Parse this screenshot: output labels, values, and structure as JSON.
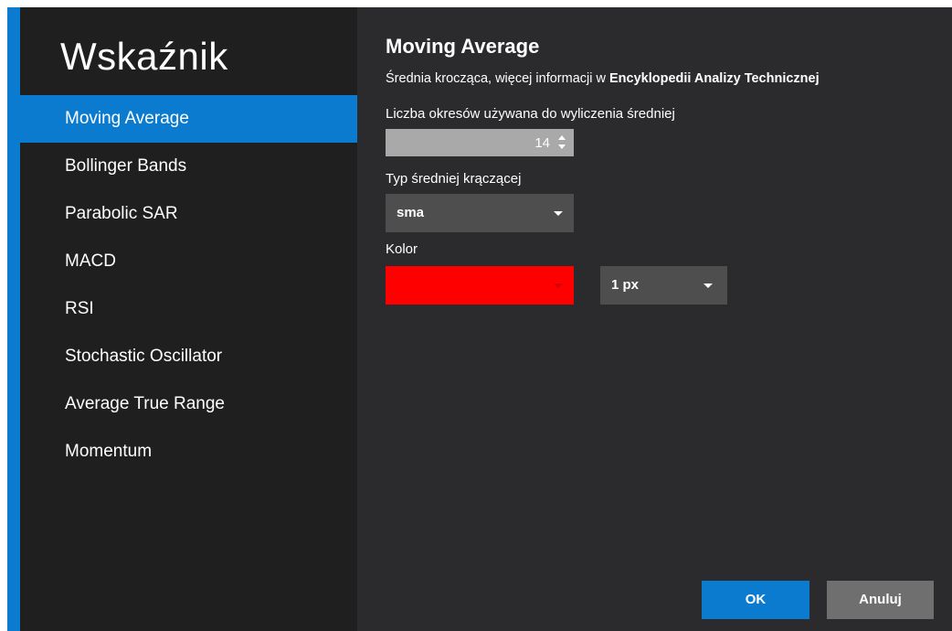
{
  "sidebar": {
    "title": "Wskaźnik",
    "items": [
      {
        "label": "Moving Average",
        "active": true
      },
      {
        "label": "Bollinger Bands"
      },
      {
        "label": "Parabolic SAR"
      },
      {
        "label": "MACD"
      },
      {
        "label": "RSI"
      },
      {
        "label": "Stochastic Oscillator"
      },
      {
        "label": "Average True Range"
      },
      {
        "label": "Momentum"
      }
    ]
  },
  "main": {
    "title": "Moving Average",
    "description_prefix": "Średnia krocząca, więcej informacji w ",
    "description_link": "Encyklopedii Analizy Technicznej",
    "periods_label": "Liczba okresów używana do wyliczenia średniej",
    "periods_value": "14",
    "type_label": "Typ średniej krączącej",
    "type_value": "sma",
    "color_label": "Kolor",
    "color_value": "#ff0000",
    "width_value": "1 px"
  },
  "buttons": {
    "ok": "OK",
    "cancel": "Anuluj"
  },
  "colors": {
    "accent": "#0b7bd0",
    "sidebar_bg": "#1f1f1f",
    "panel_bg": "#2b2b2e"
  }
}
